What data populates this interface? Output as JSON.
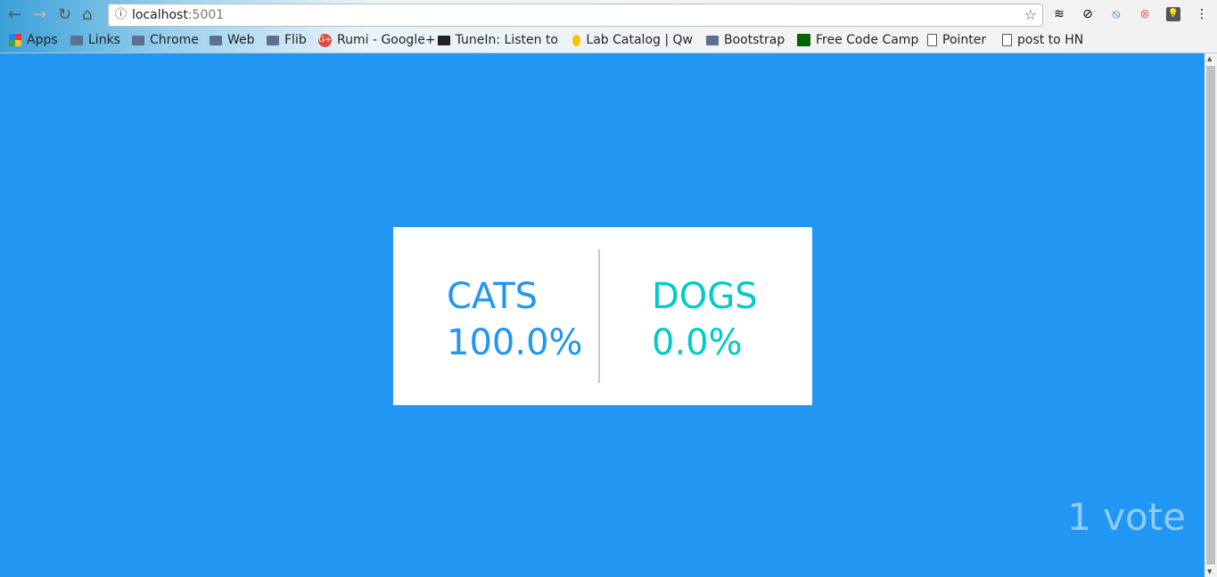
{
  "browser": {
    "url_host": "localhost",
    "url_port": ":5001",
    "bookmarks": [
      {
        "label": "Apps",
        "icon": "apps-grid-icon"
      },
      {
        "label": "Links",
        "icon": "folder-icon"
      },
      {
        "label": "Chrome",
        "icon": "folder-icon"
      },
      {
        "label": "Web",
        "icon": "folder-icon"
      },
      {
        "label": "Flib",
        "icon": "folder-icon"
      },
      {
        "label": "Rumi - Google+",
        "icon": "google-plus-icon"
      },
      {
        "label": "TuneIn: Listen to",
        "icon": "tunein-icon"
      },
      {
        "label": "Lab Catalog | Qw",
        "icon": "qwiklabs-icon"
      },
      {
        "label": "Bootstrap",
        "icon": "folder-icon"
      },
      {
        "label": "Free Code Camp",
        "icon": "freecodecamp-icon"
      },
      {
        "label": "Pointer",
        "icon": "page-icon"
      },
      {
        "label": "post to HN",
        "icon": "page-icon"
      }
    ]
  },
  "result": {
    "options": [
      {
        "label": "CATS",
        "percent": "100.0%",
        "color": "#2196f3"
      },
      {
        "label": "DOGS",
        "percent": "0.0%",
        "color": "#00cbca"
      }
    ],
    "vote_count": "1 vote"
  },
  "colors": {
    "background": "#2196f3"
  }
}
